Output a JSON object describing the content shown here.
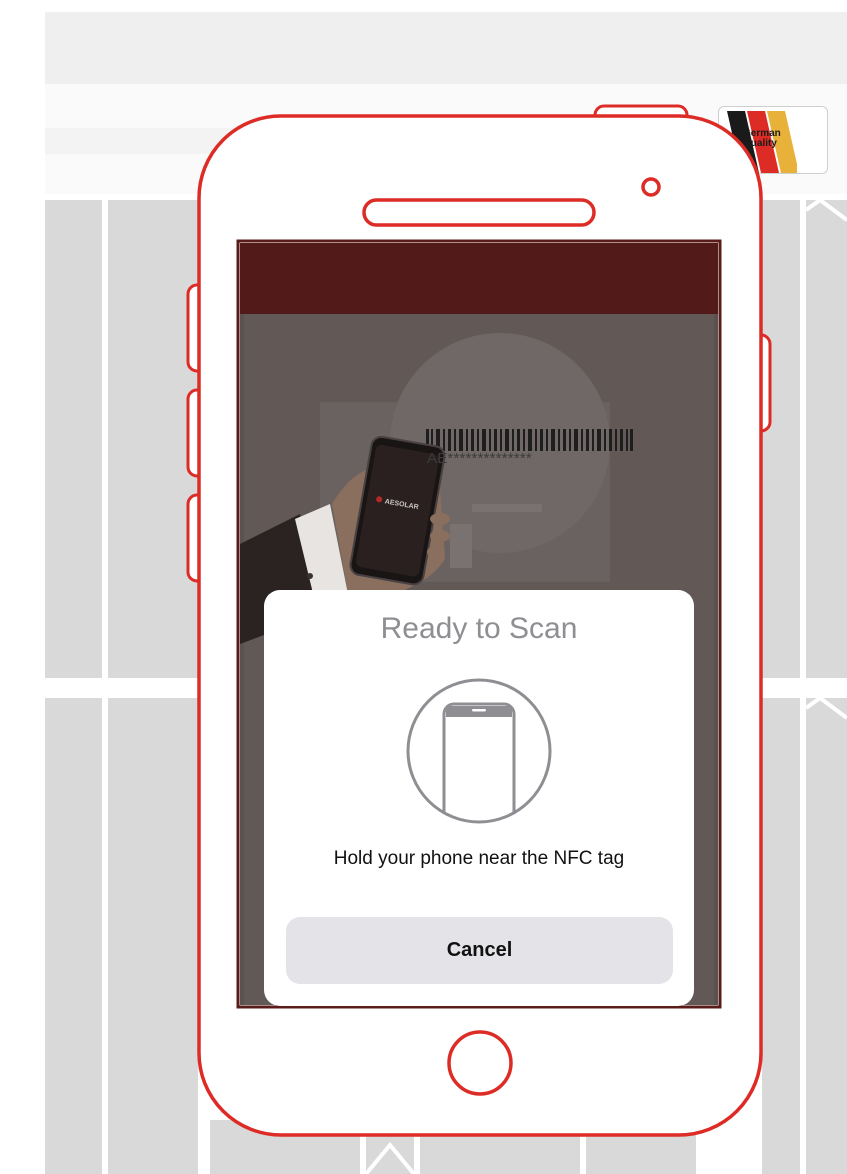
{
  "badge": {
    "line1": "German",
    "line2": "Quality"
  },
  "screen": {
    "barcode_text": "AE**************",
    "phone_brand": "AESOLAR"
  },
  "nfc_sheet": {
    "title": "Ready to Scan",
    "icon": "phone-icon",
    "message": "Hold your phone near the NFC tag",
    "cancel_label": "Cancel"
  },
  "colors": {
    "frame_red": "#dd2b26",
    "header_dark_red": "#521a18",
    "cancel_button_bg": "#e3e3e8",
    "title_gray": "#8e8e93"
  }
}
